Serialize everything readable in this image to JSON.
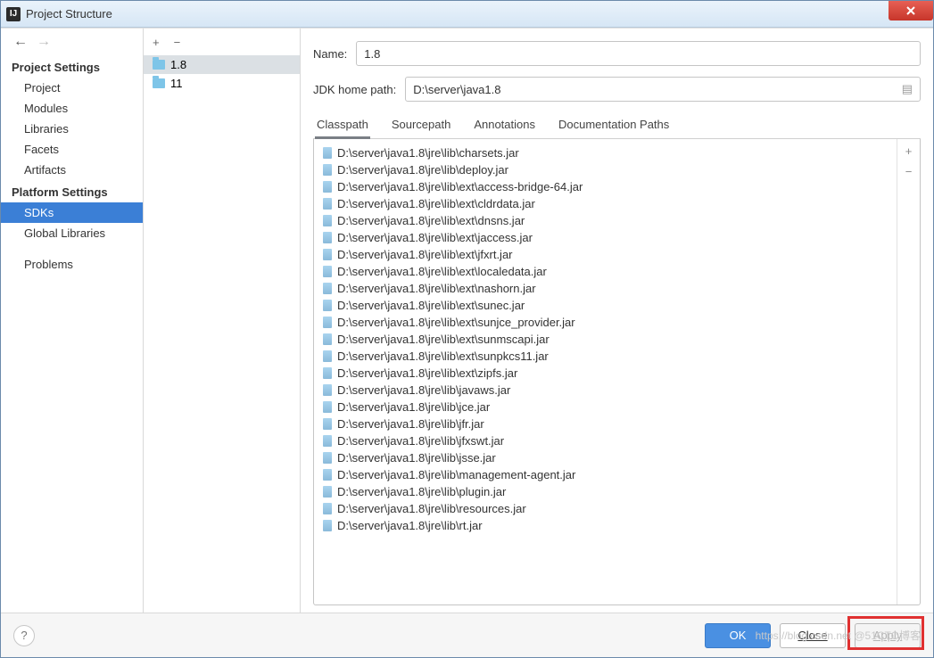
{
  "window": {
    "title": "Project Structure"
  },
  "sidebar": {
    "section1_title": "Project Settings",
    "section1_items": [
      "Project",
      "Modules",
      "Libraries",
      "Facets",
      "Artifacts"
    ],
    "section2_title": "Platform Settings",
    "section2_items": [
      "SDKs",
      "Global Libraries"
    ],
    "problems": "Problems",
    "selected": "SDKs"
  },
  "sdklist": {
    "items": [
      "1.8",
      "11"
    ],
    "selected": "1.8"
  },
  "form": {
    "name_label": "Name:",
    "name_value": "1.8",
    "home_label": "JDK home path:",
    "home_value": "D:\\server\\java1.8"
  },
  "tabs": {
    "items": [
      "Classpath",
      "Sourcepath",
      "Annotations",
      "Documentation Paths"
    ],
    "selected": "Classpath"
  },
  "classpath": [
    "D:\\server\\java1.8\\jre\\lib\\charsets.jar",
    "D:\\server\\java1.8\\jre\\lib\\deploy.jar",
    "D:\\server\\java1.8\\jre\\lib\\ext\\access-bridge-64.jar",
    "D:\\server\\java1.8\\jre\\lib\\ext\\cldrdata.jar",
    "D:\\server\\java1.8\\jre\\lib\\ext\\dnsns.jar",
    "D:\\server\\java1.8\\jre\\lib\\ext\\jaccess.jar",
    "D:\\server\\java1.8\\jre\\lib\\ext\\jfxrt.jar",
    "D:\\server\\java1.8\\jre\\lib\\ext\\localedata.jar",
    "D:\\server\\java1.8\\jre\\lib\\ext\\nashorn.jar",
    "D:\\server\\java1.8\\jre\\lib\\ext\\sunec.jar",
    "D:\\server\\java1.8\\jre\\lib\\ext\\sunjce_provider.jar",
    "D:\\server\\java1.8\\jre\\lib\\ext\\sunmscapi.jar",
    "D:\\server\\java1.8\\jre\\lib\\ext\\sunpkcs11.jar",
    "D:\\server\\java1.8\\jre\\lib\\ext\\zipfs.jar",
    "D:\\server\\java1.8\\jre\\lib\\javaws.jar",
    "D:\\server\\java1.8\\jre\\lib\\jce.jar",
    "D:\\server\\java1.8\\jre\\lib\\jfr.jar",
    "D:\\server\\java1.8\\jre\\lib\\jfxswt.jar",
    "D:\\server\\java1.8\\jre\\lib\\jsse.jar",
    "D:\\server\\java1.8\\jre\\lib\\management-agent.jar",
    "D:\\server\\java1.8\\jre\\lib\\plugin.jar",
    "D:\\server\\java1.8\\jre\\lib\\resources.jar",
    "D:\\server\\java1.8\\jre\\lib\\rt.jar"
  ],
  "footer": {
    "ok": "OK",
    "close": "Close",
    "apply": "Apply"
  },
  "watermark": "https://blog.csdn.net @51CTO博客"
}
